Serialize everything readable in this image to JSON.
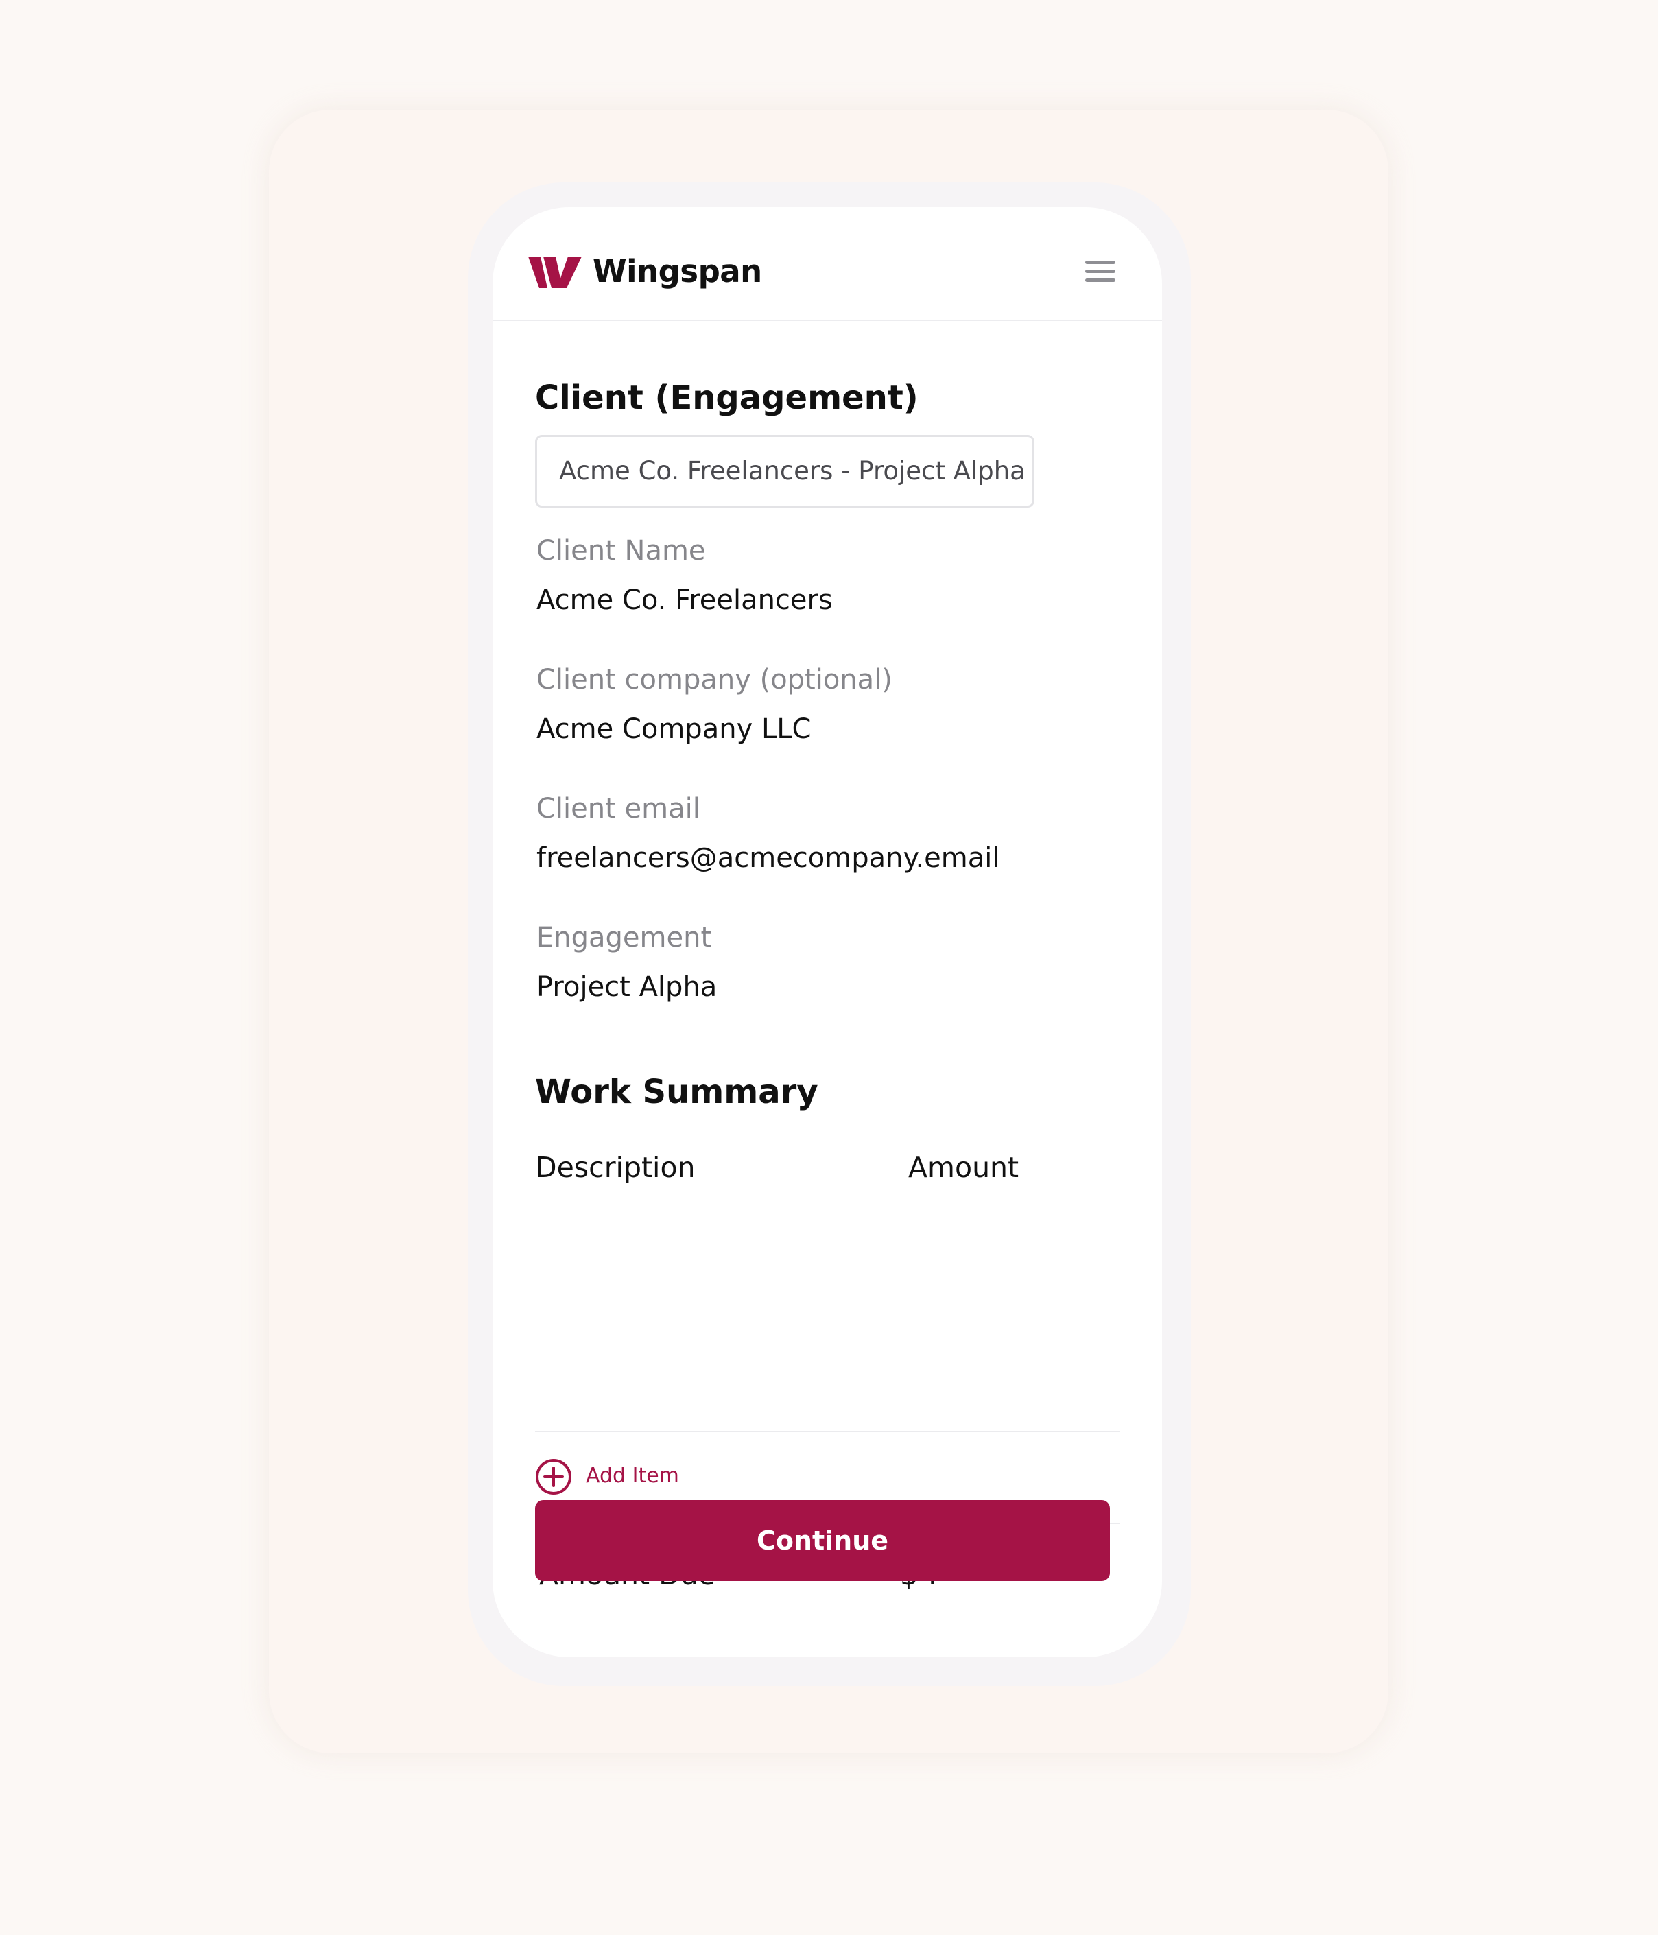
{
  "colors": {
    "brand": "#a51346",
    "page_background": "#fcf8f5",
    "label_gray": "#86868b"
  },
  "header": {
    "brand_name": "Wingspan",
    "logo_icon": "wingspan-logo-icon",
    "menu_icon": "hamburger-menu-icon"
  },
  "client_section": {
    "title": "Client (Engagement)",
    "engagement_select_value": "Acme Co. Freelancers - Project Alpha"
  },
  "fields": [
    {
      "label": "Client Name",
      "value": "Acme Co. Freelancers"
    },
    {
      "label": "Client company (optional)",
      "value": "Acme Company LLC"
    },
    {
      "label": "Client email",
      "value": "freelancers@acmecompany.email"
    },
    {
      "label": "Engagement",
      "value": "Project Alpha"
    }
  ],
  "work_summary": {
    "title": "Work Summary",
    "columns": [
      "Description",
      "Amount"
    ],
    "add_item_label": "Add Item",
    "add_item_icon": "plus-circle-icon",
    "amount_due_label": "Amount Due",
    "amount_due_value": "$-.--"
  },
  "actions": {
    "continue_label": "Continue"
  }
}
